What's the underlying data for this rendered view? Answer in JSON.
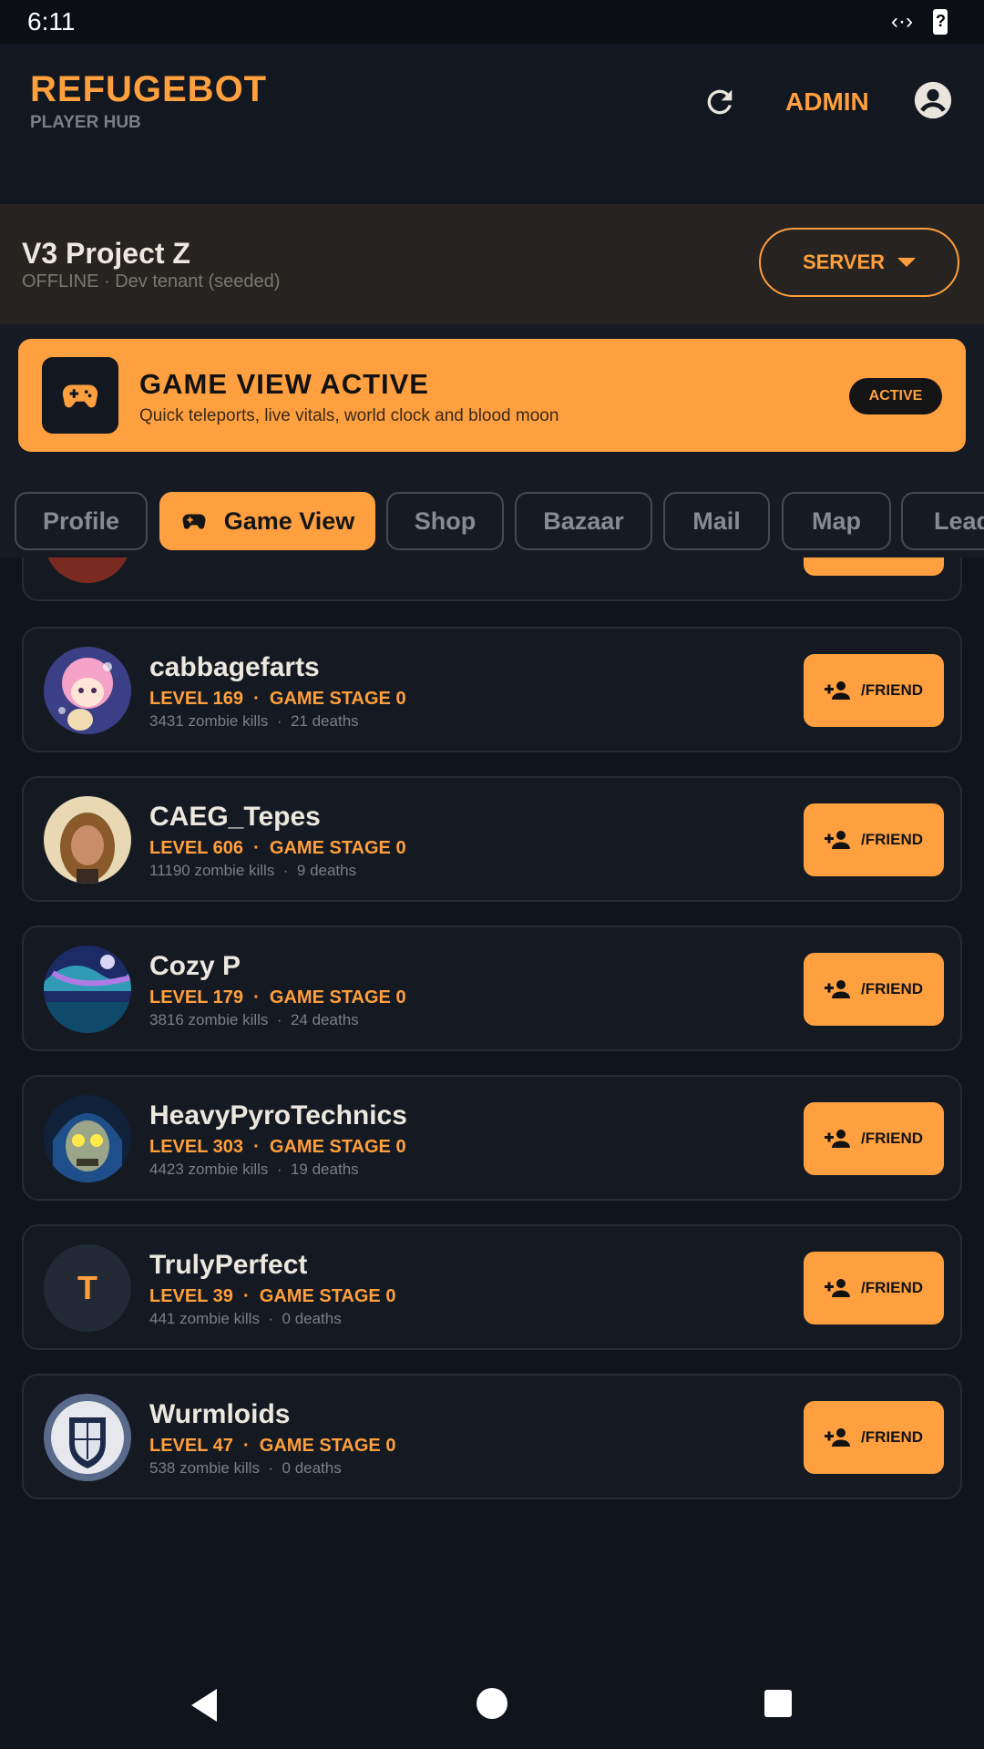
{
  "status_bar": {
    "time": "6:11",
    "network_icon": "‹·›"
  },
  "header": {
    "brand": "REFUGEBOT",
    "subtitle": "PLAYER HUB",
    "admin_label": "ADMIN",
    "icons": [
      "refresh-icon",
      "account-circle-icon"
    ]
  },
  "server": {
    "name": "V3 Project Z",
    "status": "OFFLINE · Dev tenant (seeded)",
    "button_label": "SERVER"
  },
  "banner": {
    "title": "GAME VIEW ACTIVE",
    "subtitle": "Quick teleports, live vitals, world clock and blood moon",
    "badge": "ACTIVE"
  },
  "tabs": [
    {
      "label": "Profile",
      "active": false
    },
    {
      "label": "Game View",
      "active": true
    },
    {
      "label": "Shop",
      "active": false
    },
    {
      "label": "Bazaar",
      "active": false
    },
    {
      "label": "Mail",
      "active": false
    },
    {
      "label": "Map",
      "active": false
    },
    {
      "label": "Lead",
      "active": false
    }
  ],
  "players": [
    {
      "name": "cabbagefarts",
      "level": "LEVEL 169",
      "stage": "GAME STAGE 0",
      "kills": "3431 zombie kills",
      "deaths": "21 deaths",
      "avatar": "anime-avatar"
    },
    {
      "name": "CAEG_Tepes",
      "level": "LEVEL 606",
      "stage": "GAME STAGE 0",
      "kills": "11190 zombie kills",
      "deaths": "9 deaths",
      "avatar": "photo-avatar"
    },
    {
      "name": "Cozy P",
      "level": "LEVEL 179",
      "stage": "GAME STAGE 0",
      "kills": "3816 zombie kills",
      "deaths": "24 deaths",
      "avatar": "aurora-avatar"
    },
    {
      "name": "HeavyPyroTechnics",
      "level": "LEVEL 303",
      "stage": "GAME STAGE 0",
      "kills": "4423 zombie kills",
      "deaths": "19 deaths",
      "avatar": "skull-avatar"
    },
    {
      "name": "TrulyPerfect",
      "level": "LEVEL 39",
      "stage": "GAME STAGE 0",
      "kills": "441 zombie kills",
      "deaths": "0 deaths",
      "avatar": "initial-avatar",
      "initial": "T"
    },
    {
      "name": "Wurmloids",
      "level": "LEVEL 47",
      "stage": "GAME STAGE 0",
      "kills": "538 zombie kills",
      "deaths": "0 deaths",
      "avatar": "crest-avatar"
    }
  ],
  "friend_button_label": "/FRIEND",
  "colors": {
    "accent": "#ffa040",
    "background": "#10141b",
    "card": "#151a22"
  }
}
